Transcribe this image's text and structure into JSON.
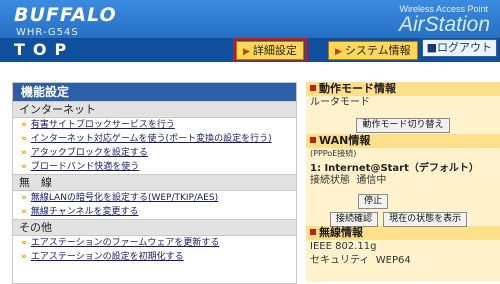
{
  "header": {
    "brand": "BUFFALO",
    "model": "WHR-G54S",
    "wap_label": "Wireless Access Point",
    "product": "AirStation",
    "page_title": "TOP"
  },
  "nav": {
    "advanced_settings": "詳細設定",
    "system_info": "システム情報",
    "logout": "ログアウト"
  },
  "left": {
    "title": "機能設定",
    "sections": [
      {
        "label": "インターネット",
        "items": [
          "有害サイトブロックサービスを行う",
          "インターネット対応ゲームを使う(ポート変換の設定を行う)",
          "アタックブロックを設定する",
          "ブロードバンド快適を使う"
        ]
      },
      {
        "label": "無　線",
        "items": [
          "無線LANの暗号化を設定する(WEP/TKIP/AES)",
          "無線チャンネルを変更する"
        ]
      },
      {
        "label": "その他",
        "items": [
          "エアステーションのファームウェアを更新する",
          "エアステーションの設定を初期化する"
        ]
      }
    ]
  },
  "right": {
    "mode_title": "動作モード情報",
    "mode_value": "ルータモード",
    "mode_switch_button": "動作モード切り替え",
    "wan_title": "WAN情報",
    "wan_sub": "(PPPoE接続)",
    "connection_name": "1: Internet@Start（デフォルト）",
    "conn_state_label": "接続状態",
    "conn_state_value": "通信中",
    "stop_button": "停止",
    "connect_confirm_button": "接続確認",
    "show_status_button": "現在の状態を表示",
    "wireless_title": "無線情報",
    "wireless_standard": "IEEE 802.11g",
    "security_label": "セキュリティ",
    "security_value": "WEP64"
  }
}
